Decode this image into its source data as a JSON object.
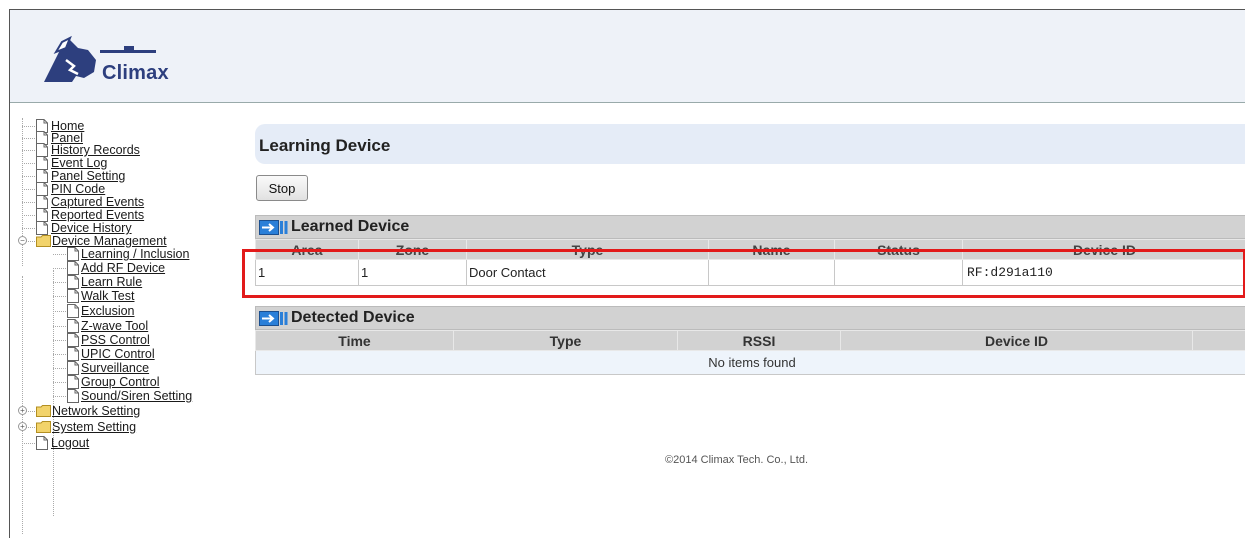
{
  "app": {
    "logo_text": "Climax"
  },
  "sidebar": {
    "items": [
      {
        "label": "Home"
      },
      {
        "label": "Panel"
      },
      {
        "label": "History Records"
      },
      {
        "label": "Event Log"
      },
      {
        "label": "Panel Setting"
      },
      {
        "label": "PIN Code"
      },
      {
        "label": "Captured Events"
      },
      {
        "label": "Reported Events"
      },
      {
        "label": "Device History"
      },
      {
        "label": "Device Management"
      },
      {
        "label": "Learning / Inclusion"
      },
      {
        "label": "Add RF Device"
      },
      {
        "label": "Learn Rule"
      },
      {
        "label": "Walk Test"
      },
      {
        "label": "Exclusion"
      },
      {
        "label": "Z-wave Tool"
      },
      {
        "label": "PSS Control"
      },
      {
        "label": "UPIC Control"
      },
      {
        "label": "Surveillance"
      },
      {
        "label": "Group Control"
      },
      {
        "label": "Sound/Siren Setting"
      },
      {
        "label": "Network Setting"
      },
      {
        "label": "System Setting"
      },
      {
        "label": "Logout"
      }
    ]
  },
  "main": {
    "title": "Learning Device",
    "stop_label": "Stop",
    "learned": {
      "title": "Learned Device",
      "columns": [
        "Area",
        "Zone",
        "Type",
        "Name",
        "Status",
        "Device ID"
      ],
      "rows": [
        {
          "area": "1",
          "zone": "1",
          "type": "Door Contact",
          "name": "",
          "status": "",
          "device_id": "RF:d291a110"
        }
      ]
    },
    "detected": {
      "title": "Detected Device",
      "columns": [
        "Time",
        "Type",
        "RSSI",
        "Device ID"
      ],
      "empty_text": "No items found"
    }
  },
  "footer": {
    "copyright": "©2014 Climax Tech. Co., Ltd."
  },
  "colors": {
    "header_bg": "#eef2f8",
    "title_bar_bg": "#e5ecf7",
    "panel_header_bg": "#d2d2d2",
    "highlight": "#e21a1a",
    "logo_blue": "#2d3f7e"
  }
}
